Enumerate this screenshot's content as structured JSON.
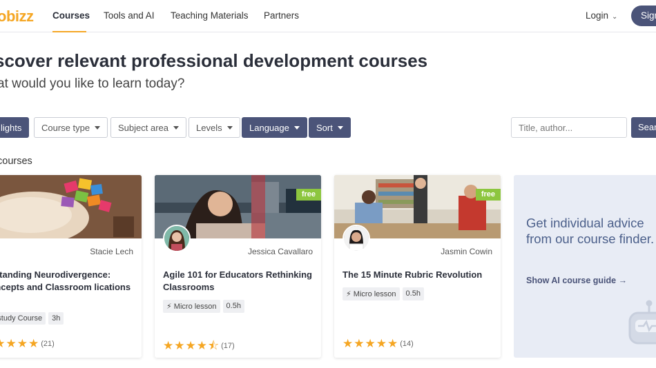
{
  "nav": {
    "logo": "obizz",
    "items": [
      "Courses",
      "Tools and AI",
      "Teaching Materials",
      "Partners"
    ],
    "login": "Login",
    "signup": "Sign"
  },
  "page": {
    "heading": "scover relevant professional development courses",
    "subheading": "at would you like to learn today?"
  },
  "filters": {
    "highlights": "lights",
    "course_type": "Course type",
    "subject_area": "Subject area",
    "levels": "Levels",
    "language": "Language",
    "sort": "Sort",
    "search_placeholder": "Title, author...",
    "search_button": "Sear"
  },
  "section_title": "courses",
  "courses": [
    {
      "author": "Stacie Lech",
      "title": "lerstanding Neurodivergence: Concepts and Classroom lications",
      "tags": [
        "elf-study Course",
        "3h"
      ],
      "rating_count": "(21)",
      "free": ""
    },
    {
      "author": "Jessica Cavallaro",
      "title": "Agile 101 for Educators Rethinking Classrooms",
      "tags": [
        "Micro lesson",
        "0.5h"
      ],
      "rating_count": "(17)",
      "free": "free"
    },
    {
      "author": "Jasmin Cowin",
      "title": "The 15 Minute Rubric Revolution",
      "tags": [
        "Micro lesson",
        "0.5h"
      ],
      "rating_count": "(14)",
      "free": "free"
    }
  ],
  "ai_card": {
    "text": "Get individual advice from our course finder.",
    "link": "Show AI course guide"
  },
  "colors": {
    "accent": "#f5a623",
    "primary": "#4b5479",
    "free_badge": "#8dc63f"
  }
}
